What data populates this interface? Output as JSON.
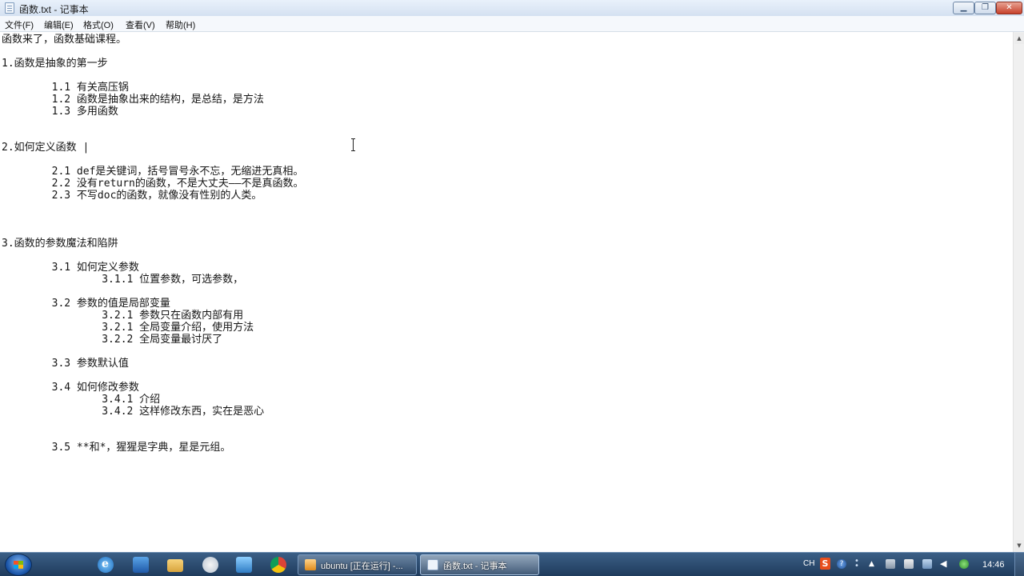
{
  "window": {
    "title": "函数.txt - 记事本",
    "minimize_glyph": "▁",
    "maximize_glyph": "❐",
    "close_glyph": "✕"
  },
  "menu": [
    {
      "label": "文件(F)"
    },
    {
      "label": "编辑(E)"
    },
    {
      "label": "格式(O)"
    },
    {
      "label": "查看(V)"
    },
    {
      "label": "帮助(H)"
    }
  ],
  "document": {
    "text": "函数来了，函数基础课程。\n\n1.函数是抽象的第一步\n\n        1.1 有关高压锅\n        1.2 函数是抽象出来的结构，是总结，是方法\n        1.3 多用函数\n\n\n2.如何定义函数 |\n\n        2.1 def是关键词，括号冒号永不忘，无缩进无真相。\n        2.2 没有return的函数，不是大丈夫——不是真函数。\n        2.3 不写doc的函数，就像没有性别的人类。\n\n\n\n3.函数的参数魔法和陷阱\n\n        3.1 如何定义参数\n                3.1.1 位置参数，可选参数，\n\n        3.2 参数的值是局部变量\n                3.2.1 参数只在函数内部有用\n                3.2.1 全局变量介绍，使用方法\n                3.2.2 全局变量最讨厌了\n\n        3.3 参数默认值\n\n        3.4 如何修改参数\n                3.4.1 介绍\n                3.4.2 这样修改东西，实在是恶心\n\n\n        3.5 **和*，猩猩是字典，星是元组。"
  },
  "scrollbar": {
    "up_glyph": "▲",
    "down_glyph": "▼"
  },
  "taskbar": {
    "quick_launch_icons": [
      "ie-icon",
      "media-icon",
      "folder-icon",
      "messenger-icon",
      "virtualbox-icon",
      "chrome-icon"
    ],
    "tasks": [
      {
        "label": "ubuntu [正在运行] -...",
        "icon": "virtualbox-window-icon"
      },
      {
        "label": "函数.txt - 记事本",
        "icon": "notepad-icon"
      }
    ],
    "tray": {
      "language": "CH",
      "sogou_glyph": "S",
      "help_glyph": "?",
      "clock": "14:46"
    }
  }
}
